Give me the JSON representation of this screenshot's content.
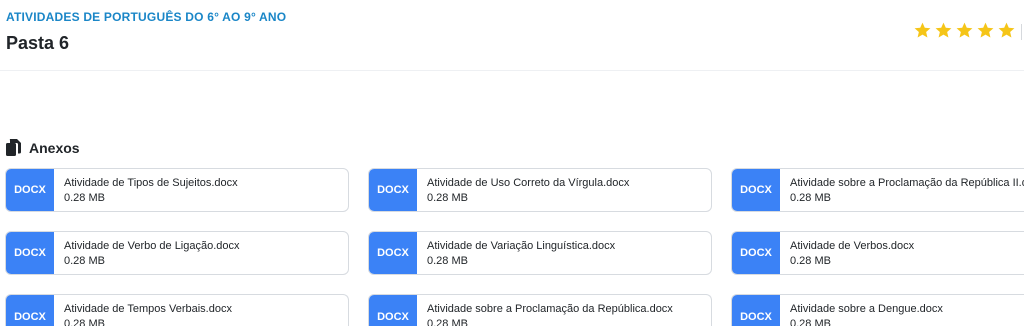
{
  "header": {
    "kicker": "ATIVIDADES DE PORTUGUÊS DO 6° AO 9° ANO",
    "title": "Pasta 6",
    "rating": {
      "value": 5,
      "max": 5,
      "star_color": "#f5c518"
    }
  },
  "attachments": {
    "title": "Anexos",
    "icon": "files-icon",
    "badge_color": "#3b82f6",
    "items": [
      {
        "type": "DOCX",
        "name": "Atividade de Tipos de Sujeitos.docx",
        "size": "0.28 MB"
      },
      {
        "type": "DOCX",
        "name": "Atividade de Uso Correto da Vírgula.docx",
        "size": "0.28 MB"
      },
      {
        "type": "DOCX",
        "name": "Atividade sobre a Proclamação da República II.docx",
        "size": "0.28 MB"
      },
      {
        "type": "DOCX",
        "name": "Atividade de Verbo de Ligação.docx",
        "size": "0.28 MB"
      },
      {
        "type": "DOCX",
        "name": "Atividade de Variação Linguística.docx",
        "size": "0.28 MB"
      },
      {
        "type": "DOCX",
        "name": "Atividade de Verbos.docx",
        "size": "0.28 MB"
      },
      {
        "type": "DOCX",
        "name": "Atividade de Tempos Verbais.docx",
        "size": "0.28 MB"
      },
      {
        "type": "DOCX",
        "name": "Atividade sobre a Proclamação da República.docx",
        "size": "0.28 MB"
      },
      {
        "type": "DOCX",
        "name": "Atividade sobre a Dengue.docx",
        "size": "0.28 MB"
      }
    ]
  }
}
